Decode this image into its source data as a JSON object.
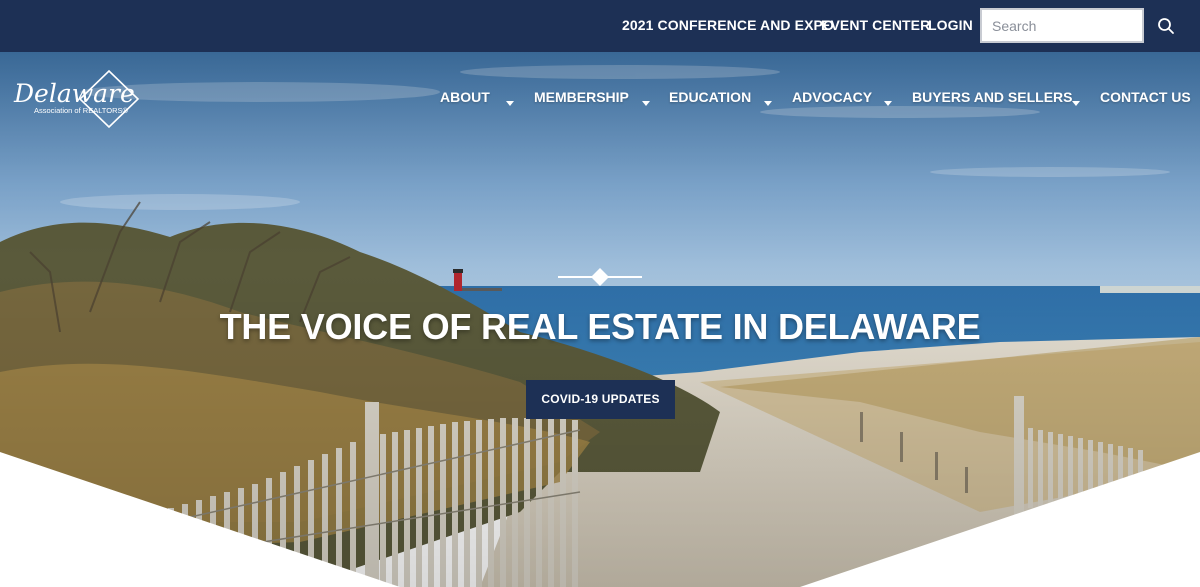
{
  "topbar": {
    "links": [
      {
        "label": "2021 CONFERENCE AND EXPO"
      },
      {
        "label": "EVENT CENTER"
      },
      {
        "label": "LOGIN"
      }
    ],
    "search": {
      "placeholder": "Search",
      "value": ""
    },
    "search_icon": "search-icon"
  },
  "logo": {
    "script": "Delaware",
    "subline": "Association of REALTORS®"
  },
  "nav": {
    "items": [
      {
        "label": "ABOUT",
        "has_dropdown": true
      },
      {
        "label": "MEMBERSHIP",
        "has_dropdown": true
      },
      {
        "label": "EDUCATION",
        "has_dropdown": true
      },
      {
        "label": "ADVOCACY",
        "has_dropdown": true
      },
      {
        "label": "BUYERS AND SELLERS",
        "has_dropdown": true
      },
      {
        "label": "CONTACT US",
        "has_dropdown": false
      }
    ]
  },
  "hero": {
    "headline": "THE VOICE OF REAL ESTATE IN DELAWARE",
    "cta_label": "COVID-19 UPDATES"
  },
  "colors": {
    "brand_navy": "#1d3055",
    "white": "#ffffff"
  }
}
